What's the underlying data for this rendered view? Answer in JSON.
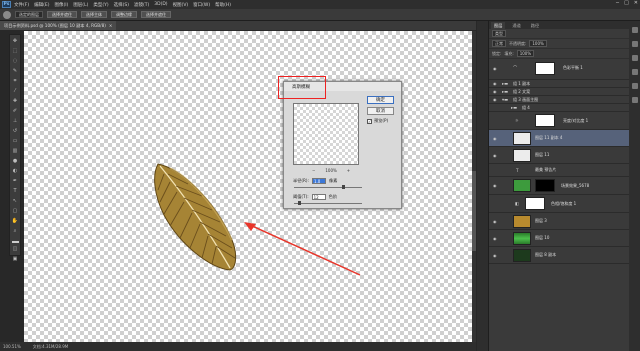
{
  "app": {
    "logo": "Ps"
  },
  "menu": [
    "文件(F)",
    "编辑(E)",
    "图像(I)",
    "图层(L)",
    "类型(Y)",
    "选择(S)",
    "滤镜(T)",
    "3D(D)",
    "视图(V)",
    "窗口(W)",
    "帮助(H)"
  ],
  "window_controls": [
    "─",
    "□",
    "✕"
  ],
  "options_bar": {
    "select_label": "选定的图层",
    "buttons": [
      "选择并遮住",
      "选择主体",
      "调整边缘",
      "选择并遮住"
    ]
  },
  "document_tab": {
    "title": "项目示例资料.psd @ 100% (图层 10 副本 4, RGB/8)",
    "close": "×"
  },
  "statusbar": {
    "zoom": "100.51%",
    "doc_size": "文档:4.31M/28.9M"
  },
  "dialog": {
    "title": "高斯模糊",
    "ok": "确定",
    "cancel": "取消",
    "preview_label": "预览(P)",
    "preview_checked": "✓",
    "zoom_out": "−",
    "zoom_level": "100%",
    "zoom_in": "+",
    "radius_label": "半径(R):",
    "radius_value": "1.0",
    "radius_unit": "像素",
    "threshold_label": "阈值(T):",
    "threshold_value": "12",
    "threshold_unit": "色阶"
  },
  "layers_panel": {
    "tabs": [
      "图层",
      "通道",
      "路径"
    ],
    "filter_label": "类型",
    "mode_label": "正常",
    "opacity_label": "不透明度:",
    "opacity_value": "100%",
    "lock_label": "锁定:",
    "fill_label": "填充:",
    "fill_value": "100%",
    "layers": [
      {
        "name": "色彩平衡 1",
        "type": "adjust",
        "thumb": "#ffffff"
      },
      {
        "name": "组 1 副本",
        "type": "group"
      },
      {
        "name": "组 2 文案",
        "type": "group"
      },
      {
        "name": "组 3 画面主图",
        "type": "group"
      },
      {
        "name": "组 4",
        "type": "group"
      },
      {
        "name": "亮度/对比度 1",
        "type": "adjust",
        "thumb": "#ffffff"
      },
      {
        "name": "图层 11 副本 4",
        "type": "pixel",
        "thumb": "#ececec"
      },
      {
        "name": "图层 11",
        "type": "pixel",
        "thumb": "#ececec"
      },
      {
        "name": "最美 预告片",
        "type": "text"
      },
      {
        "name": "场景效果_5678",
        "type": "masked",
        "thumb": "#3d9b3d"
      },
      {
        "name": "色相/饱和度 1",
        "type": "adjust",
        "thumb": "#ffffff"
      },
      {
        "name": "图层 3",
        "type": "pixel",
        "thumb": "#b88a2e"
      },
      {
        "name": "图层 10",
        "type": "pixel",
        "thumb": "#3aa03a"
      },
      {
        "name": "图层 8 副本",
        "type": "pixel",
        "thumb": "#1d3a1d"
      }
    ]
  }
}
